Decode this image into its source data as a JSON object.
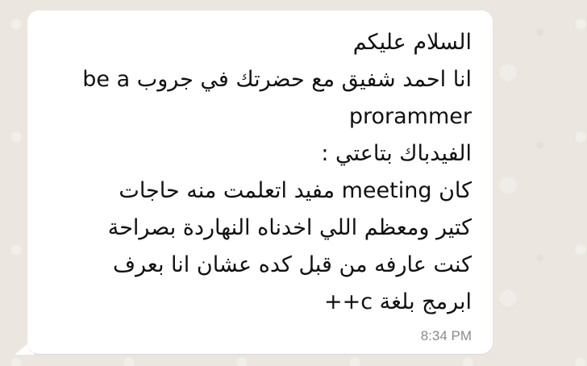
{
  "message": {
    "lines": [
      "السلام عليكم",
      "انا احمد شفيق مع حضرتك في جروب be a",
      "prorammer",
      "الفيدباك بتاعتي :",
      "كان meeting مفيد اتعلمت منه حاجات",
      "كتير ومعظم اللي اخدناه النهاردة بصراحة",
      "كنت عارفه من قبل كده عشان انا بعرف",
      "ابرمج بلغة c++"
    ],
    "time": "8:34 PM"
  },
  "colors": {
    "bubble": "#ffffff",
    "wallpaper": "#ebe6df",
    "text": "#111111",
    "timestamp": "#8b8b8b"
  }
}
